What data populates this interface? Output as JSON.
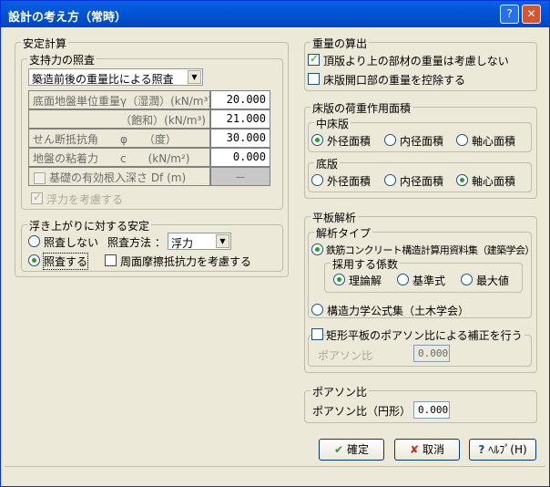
{
  "window": {
    "title": "設計の考え方（常時）",
    "help_btn": "?",
    "close_btn": "✕"
  },
  "anteikeisan": {
    "label": "安定計算",
    "shiji": {
      "label": "支持力の照査",
      "method": "築造前後の重量比による照査",
      "rows": [
        {
          "label": "底面地盤単位重量γ（湿潤）(kN/m³)",
          "value": "20.000"
        },
        {
          "label": "（飽和）(kN/m³)",
          "value": "21.000"
        },
        {
          "label": "せん断抵抗角　　φ　　（度）",
          "value": "30.000"
        },
        {
          "label": "地盤の粘着力　　c　　(kN/m²)",
          "value": "0.000"
        },
        {
          "label": "基礎の有効根入深さ Df (m)",
          "value": "－"
        }
      ],
      "fuuryoku_label": "浮力を考慮する"
    },
    "uki": {
      "label": "浮き上がりに対する安定",
      "opt_none": "照査しない",
      "opt_check": "照査する",
      "method_label": "照査方法 ：",
      "method_value": "浮力",
      "friction_label": "周面摩擦抵抗力を考慮する"
    }
  },
  "juryo": {
    "label": "重量の算出",
    "top_label": "頂版より上の部材の重量は考慮しない",
    "opening_label": "床版開口部の重量を控除する"
  },
  "shoban": {
    "label": "床版の荷重作用面積",
    "naka": {
      "label": "中床版",
      "o1": "外径面積",
      "o2": "内径面積",
      "o3": "軸心面積"
    },
    "soko": {
      "label": "底版",
      "o1": "外径面積",
      "o2": "内径面積",
      "o3": "軸心面積"
    }
  },
  "heiban": {
    "label": "平板解析",
    "type": {
      "label": "解析タイプ",
      "o1": "鉄筋コンクリート構造計算用資料集（建築学会）",
      "coef_label": "採用する係数",
      "c1": "理論解",
      "c2": "基準式",
      "c3": "最大値",
      "o2": "構造力学公式集（土木学会）"
    },
    "rect_label": "矩形平板のポアソン比による補正を行う",
    "poisson_label": "ポアソン比",
    "poisson_value": "0.000"
  },
  "poisson": {
    "label": "ポアソン比",
    "field_label": "ポアソン比（円形）",
    "value": "0.000"
  },
  "buttons": {
    "ok": "確定",
    "ok_icon": "✔",
    "cancel": "取消",
    "cancel_icon": "✘",
    "help": "ﾍﾙﾌﾟ(H)",
    "help_icon": "?"
  }
}
